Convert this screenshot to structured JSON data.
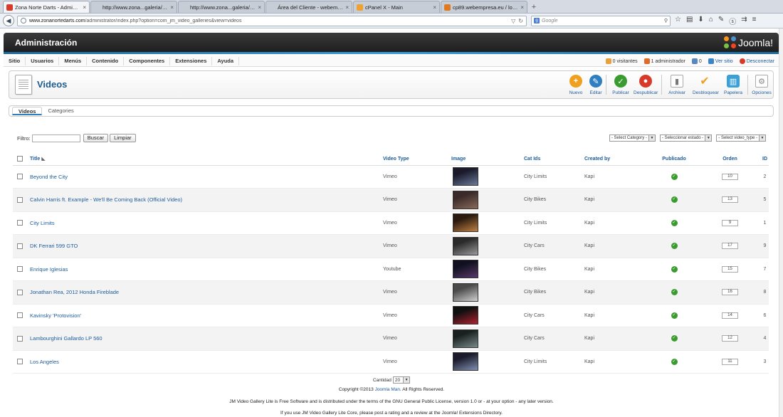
{
  "browser": {
    "tabs": [
      {
        "title": "Zona Norte Darts - Admini...",
        "active": true,
        "favicon_color": "#d83a2a"
      },
      {
        "title": "http://www.zona...galeria/videos",
        "active": false,
        "favicon_color": ""
      },
      {
        "title": "http://www.zona...galeria/videos",
        "active": false,
        "favicon_color": ""
      },
      {
        "title": "Área del Cliente - webempresa...",
        "active": false,
        "favicon_color": ""
      },
      {
        "title": "cPanel X - Main",
        "active": false,
        "favicon_color": "#f0a030"
      },
      {
        "title": "cp89.webempresa.eu / loc...",
        "active": false,
        "favicon_color": "#e07a20"
      }
    ],
    "url_host": "www.zonanortedarts.com",
    "url_path": "/administrator/index.php?option=com_jm_video_galleries&view=videos",
    "search_placeholder": "Google"
  },
  "header": {
    "title": "Administración",
    "logo_text": "Joomla!"
  },
  "menu": {
    "items": [
      "Sitio",
      "Usuarios",
      "Menús",
      "Contenido",
      "Componentes",
      "Extensiones",
      "Ayuda"
    ],
    "status": {
      "visitors": "0 visitantes",
      "admins": "1 administrador",
      "messages": "0",
      "view_site": "Ver sitio",
      "logout": "Desconectar"
    }
  },
  "toolbar": {
    "page_title": "Videos",
    "buttons": [
      {
        "label": "Nuevo",
        "icon": "plus-icon",
        "color": "#f0a020",
        "glyph": "+"
      },
      {
        "label": "Editar",
        "icon": "pencil-icon",
        "color": "#2d7fc1",
        "glyph": "✎"
      },
      {
        "label": "Publicar",
        "icon": "check-icon",
        "color": "#3a9b2e",
        "glyph": "✓"
      },
      {
        "label": "Despublicar",
        "icon": "unpublish-icon",
        "color": "#d83a2a",
        "glyph": "●"
      },
      {
        "label": "Archivar",
        "icon": "archive-icon",
        "color": "#777777",
        "glyph": "▮"
      },
      {
        "label": "Desbloquear",
        "icon": "checkin-icon",
        "color": "#f0a020",
        "glyph": "✔"
      },
      {
        "label": "Papelera",
        "icon": "trash-icon",
        "color": "#3aa0d8",
        "glyph": "▥"
      },
      {
        "label": "Opciones",
        "icon": "options-icon",
        "color": "#888888",
        "glyph": "⚙"
      }
    ]
  },
  "subnav": {
    "tabs": [
      {
        "label": "Videos",
        "active": true
      },
      {
        "label": "Categories",
        "active": false
      }
    ]
  },
  "filter": {
    "label": "Filtro:",
    "search_value": "",
    "search_button": "Buscar",
    "clear_button": "Limpiar",
    "selects": [
      "- Select Category -",
      "- Seleccionar estado -",
      "- Select video_type -"
    ]
  },
  "table": {
    "headers": {
      "title": "Title",
      "video_type": "Video Type",
      "image": "Image",
      "cat_ids": "Cat Ids",
      "created_by": "Created by",
      "published": "Publicado",
      "ordering": "Orden",
      "id": "ID"
    },
    "rows": [
      {
        "title": "Beyond the City",
        "video_type": "Vimeo",
        "cat": "City Limits",
        "author": "Kapi",
        "order": "10",
        "id": "2",
        "thumb": [
          "#1a1a2a",
          "#6a7a9a"
        ]
      },
      {
        "title": "Calvin Harris ft. Example - We'll Be Coming Back (Official Video)",
        "video_type": "Vimeo",
        "cat": "City Bikes",
        "author": "Kapi",
        "order": "13",
        "id": "5",
        "thumb": [
          "#3a2a2a",
          "#8a6a5a"
        ]
      },
      {
        "title": "City Limits",
        "video_type": "Vimeo",
        "cat": "City Limits",
        "author": "Kapi",
        "order": "9",
        "id": "1",
        "thumb": [
          "#2a1a10",
          "#c08040"
        ]
      },
      {
        "title": "DK Ferrari 599 GTO",
        "video_type": "Vimeo",
        "cat": "City Cars",
        "author": "Kapi",
        "order": "17",
        "id": "9",
        "thumb": [
          "#2a2a2a",
          "#9a9a9a"
        ]
      },
      {
        "title": "Enrique Iglesias",
        "video_type": "Youtube",
        "cat": "City Bikes",
        "author": "Kapi",
        "order": "15",
        "id": "7",
        "thumb": [
          "#101020",
          "#5a3a6a"
        ]
      },
      {
        "title": "Jonathan Rea, 2012 Honda Fireblade",
        "video_type": "Vimeo",
        "cat": "City Bikes",
        "author": "Kapi",
        "order": "16",
        "id": "8",
        "thumb": [
          "#4a4a4a",
          "#d0d0d0"
        ]
      },
      {
        "title": "Kavinsky 'Protovision'",
        "video_type": "Vimeo",
        "cat": "City Cars",
        "author": "Kapi",
        "order": "14",
        "id": "6",
        "thumb": [
          "#101010",
          "#b02030"
        ]
      },
      {
        "title": "Lambourghini Gallardo LP 560",
        "video_type": "Vimeo",
        "cat": "City Cars",
        "author": "Kapi",
        "order": "12",
        "id": "4",
        "thumb": [
          "#1a2020",
          "#7a8a8a"
        ]
      },
      {
        "title": "Los Angeles",
        "video_type": "Vimeo",
        "cat": "City Limits",
        "author": "Kapi",
        "order": "11",
        "id": "3",
        "thumb": [
          "#1a1a2a",
          "#8090b0"
        ]
      }
    ]
  },
  "footer": {
    "limit_label": "Cantidad",
    "limit_value": "20",
    "copyright_pre": "Copyright ©2013",
    "copyright_link": "Joomla Man",
    "copyright_post": ". All Rights Reserved.",
    "license": "JM Video Gallery Lite is Free Software and is distributed under the terms of the GNU General Public License, version 1.0 or - at your option - any later version.",
    "rating": "If you use JM Video Gallery Lite Core, please post a rating and a review at the Joomla! Extensions Directory."
  }
}
